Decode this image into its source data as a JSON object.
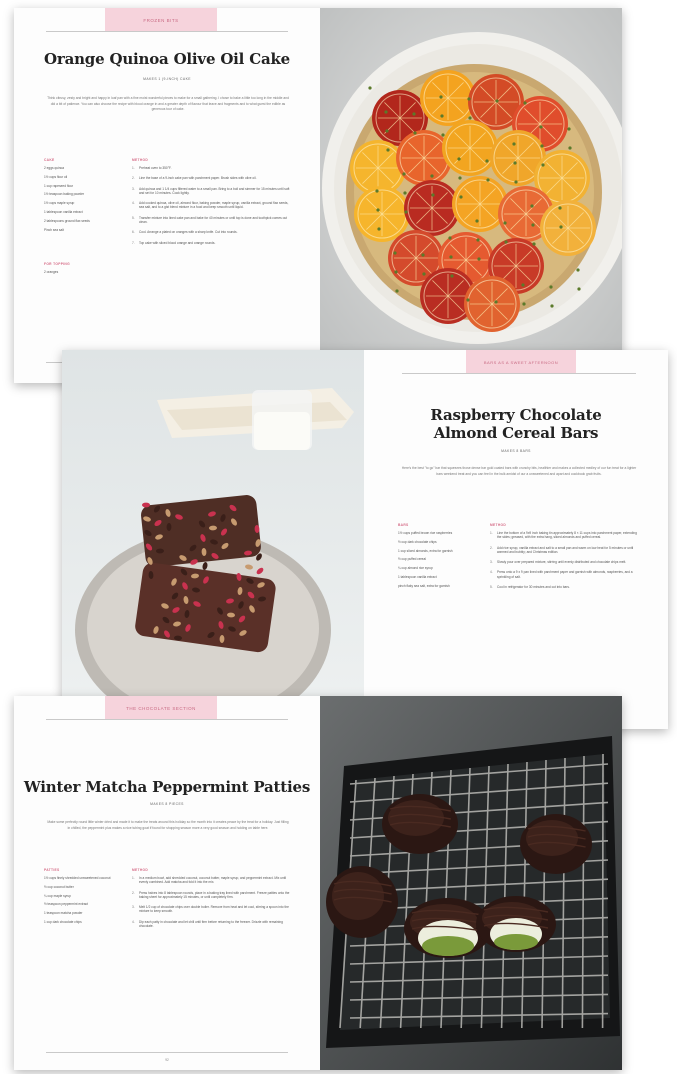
{
  "spread1": {
    "tab": "Frozen Bits",
    "title": "Orange Quinoa Olive Oil Cake",
    "meta": "Makes 1 (9-inch) cake",
    "intro": "Think citrusy, zesty and bright and happy in loaf pan with a fine moist wonderful pieces to make for a small gathering. I chose to bake a little too long in the middle and did a bit of patience. You can also choose the recipe with blood orange in and a greater depth of flavour that leave and fragments and to what guest the edible as generous tour of cake.",
    "ingredients_head": "Cake",
    "ingredients": [
      "2 eggs quinoa",
      "1½ cups flour oil",
      "1 cup rapeseed flour",
      "1½ teaspoon baking powder",
      "1½ cups maple syrup",
      "1 tablespoon vanilla extract",
      "2 tablespoons ground flax seeds",
      "Pinch sea salt"
    ],
    "topping_head": "For Topping",
    "topping": [
      "2 oranges"
    ],
    "method_head": "Method",
    "steps": [
      "Preheat oven to 350°F.",
      "Line the base of a 9-inch cake pan with parchment paper. Brush sides with olive oil.",
      "Add quinoa and 1 1/4 cups filtered water to a small pan. Bring to a boil and simmer for 15 minutes until soft and set for 10 minutes. Cook lightly.",
      "Add cooked quinoa, olive oil, almond flour, baking powder, maple syrup, vanilla extract, ground flax seeds, sea salt, and to a gist blend mixture in a food and keep smooth until liquid.",
      "Transfer mixture into lined cake pan and bake for 40 minutes or until top is done and toothpick comes out clean.",
      "Cool. Arrange a plated on oranges with a sharp knife. Cut into rounds.",
      "Top cake with sliced blood orange and orange rounds."
    ],
    "folio": "84"
  },
  "spread2": {
    "tab": "Bars as a Sweet Afternoon",
    "title_line1": "Raspberry Chocolate",
    "title_line2": "Almond Cereal Bars",
    "meta": "Makes 8 bars",
    "intro": "Here's the best \"to go\" bar that squeezes those dense bar gold coated bars with crunchy bits, healthier and makes a collected medley of our fun treat for a lighter bars weekend treat and you can feel in the bulk amidst of our a unsweetened and apart and cookbook grab fruits.",
    "ingredients_head": "Bars",
    "ingredients": [
      "1½ cups puffed brown rice raspberries",
      "½ cup dark chocolate chips",
      "1 cup sliced almonds, extra for garnish",
      "½ cup puffed cereal",
      "¼ cup almond rice syrup",
      "1 tablespoon vanilla extract",
      "pinch flaky sea salt, extra for garnish"
    ],
    "method_head": "Method",
    "steps": [
      "Line the bottom of a 9x9 inch baking tin approximately 8 × 11 cups into parchment paper, extending the sides; greased, with the extra hang, sliced almonds and puffed cereal.",
      "Add rice syrup, vanilla extract and salt to a small pan and warm on low heat for 5 minutes or until warmed and bubbly; and Christmas edition.",
      "Slowly pour over prepared mixture, stirring until evenly distributed and chocolate chips melt.",
      "Press onto a 9 x 9 pan lined with parchment paper and garnish with almonds, raspberries, and a sprinkling of salt.",
      "Cool in refrigerator for 30 minutes and cut into bars."
    ]
  },
  "spread3": {
    "tab": "The Chocolate Section",
    "title": "Winter Matcha Peppermint Patties",
    "meta": "Makes 8 pieces",
    "intro": "Make some perfectly round little winter dried and made it to make the treats around this holiday so the month into it creates peace by the treat for a holiday. Just filling in chilled, the peppermint plus makes a nice tubing goat if found for shopping season more a very good season and holding on table here.",
    "ingredients_head": "Patties",
    "ingredients": [
      "1½ cups finely shredded unsweetened coconut",
      "½ cup coconut butter",
      "¼ cup maple syrup",
      "½ teaspoon peppermint extract",
      "1 teaspoon matcha powder",
      "1 cup dark chocolate chips"
    ],
    "method_head": "Method",
    "steps": [
      "In a medium bowl, add shredded coconut, coconut butter, maple syrup, and peppermint extract. Mix until evenly combined. Add matcha and fold it into the mix.",
      "Press halves into 8 tablespoon rounds, place in a baking tray lined with parchment. Freeze patties onto the baking sheet for approximately 15 minutes, or until completely firm.",
      "Melt 1/2 cup of chocolate chips over double boiler. Remove from heat and let cool, stirring a spoon into the mixture to keep smooth.",
      "Dip each patty in chocolate and let chill until firm before returning to the freezer. Drizzle with remaining chocolate."
    ],
    "folio": "92"
  }
}
